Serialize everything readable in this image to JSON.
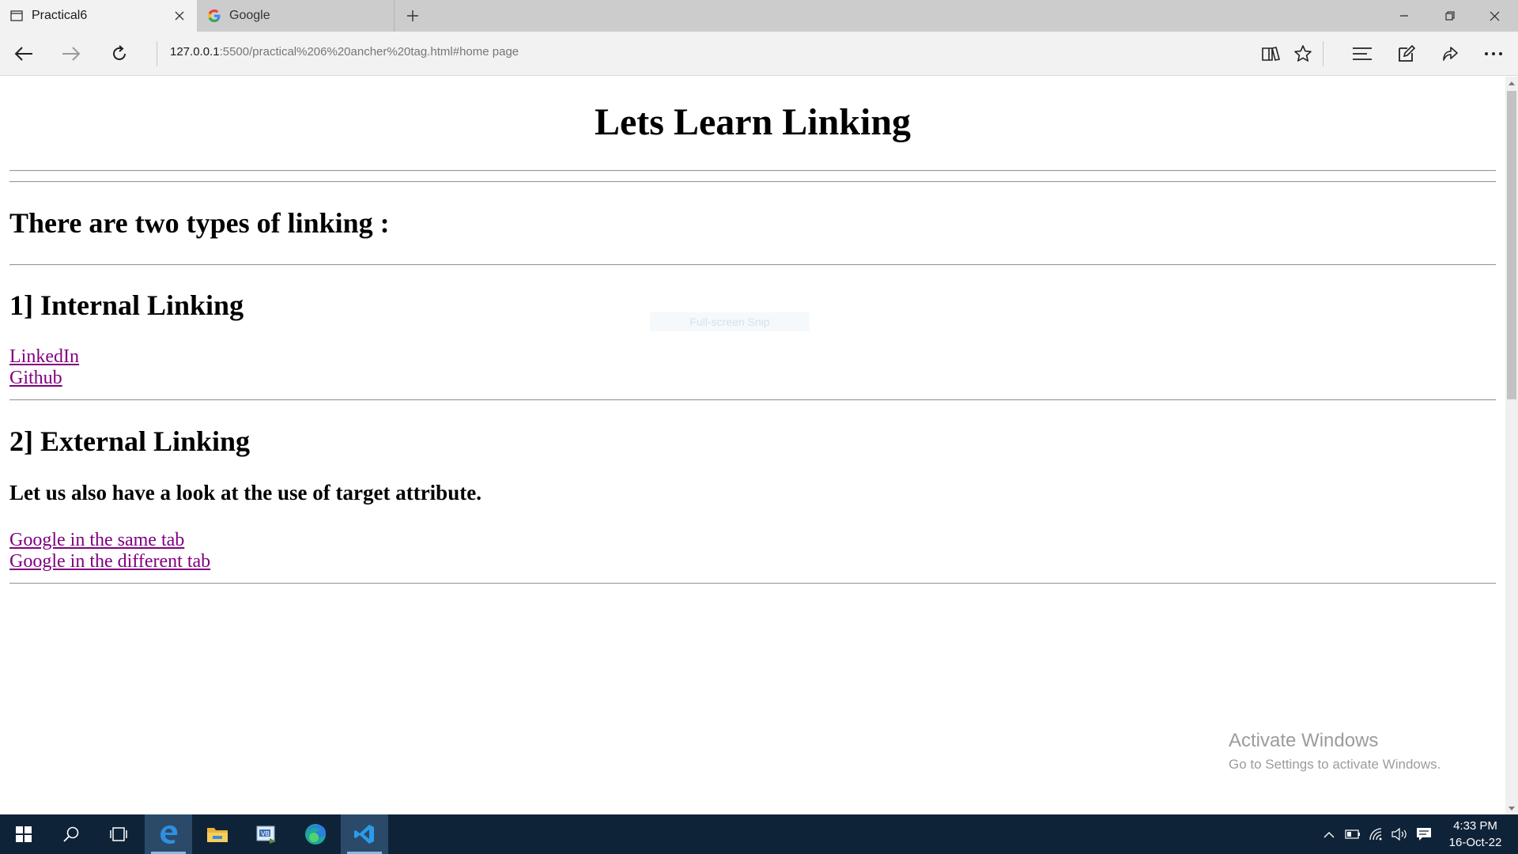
{
  "browser": {
    "tabs": [
      {
        "title": "Practical6",
        "icon": "page-icon",
        "active": true
      },
      {
        "title": "Google",
        "icon": "google-g-icon",
        "active": false
      }
    ],
    "url_host": "127.0.0.1",
    "url_rest": ":5500/practical%206%20ancher%20tag.html#home page"
  },
  "page": {
    "title": "Lets Learn Linking",
    "intro_heading": "There are two types of linking :",
    "internal_heading": "1] Internal Linking",
    "internal_links": [
      "LinkedIn",
      "Github"
    ],
    "external_heading": "2] External Linking",
    "target_note": "Let us also have a look at the use of target attribute.",
    "external_links": [
      "Google in the same tab",
      "Google in the different tab"
    ],
    "link_color": "#800080"
  },
  "overlays": {
    "snip_tooltip": "Full-screen Snip",
    "activate_title": "Activate Windows",
    "activate_sub": "Go to Settings to activate Windows."
  },
  "taskbar": {
    "time": "4:33 PM",
    "date": "16-Oct-22",
    "pinned": [
      "start-icon",
      "search-icon",
      "task-view-icon",
      "edge-legacy-icon",
      "file-explorer-icon",
      "vb-app-icon",
      "edge-chromium-icon",
      "vscode-icon"
    ]
  }
}
